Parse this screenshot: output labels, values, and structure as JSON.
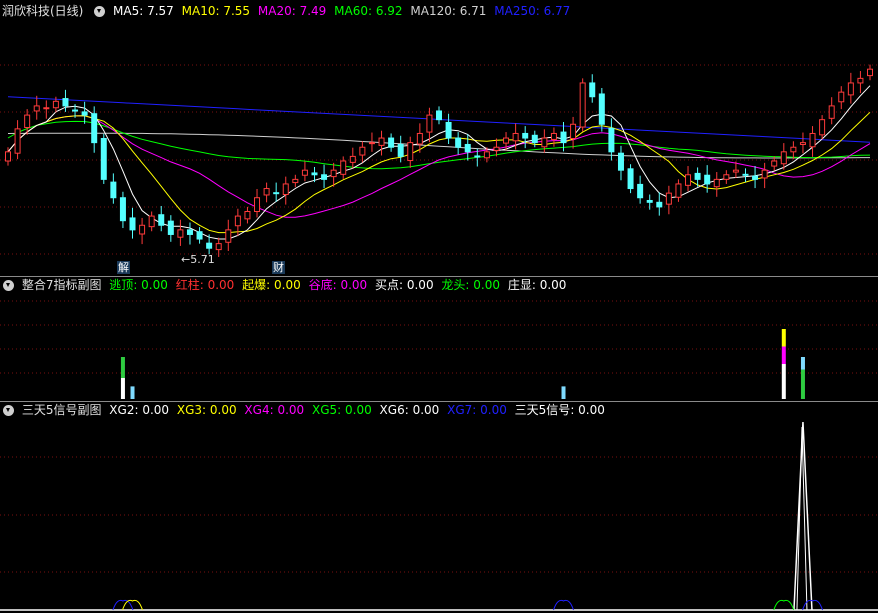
{
  "main": {
    "title": "润欣科技(日线)",
    "ma": [
      {
        "label": "MA5: 7.57",
        "color": "#ffffff"
      },
      {
        "label": "MA10: 7.55",
        "color": "#ffff00"
      },
      {
        "label": "MA20: 7.49",
        "color": "#ff00ff"
      },
      {
        "label": "MA60: 6.92",
        "color": "#00ff00"
      },
      {
        "label": "MA120: 6.71",
        "color": "#d0d0d0"
      },
      {
        "label": "MA250: 6.77",
        "color": "#2020ff"
      }
    ],
    "low_label": "←5.71",
    "event_labels": [
      "解",
      "财"
    ]
  },
  "sub1": {
    "title": "整合7指标副图",
    "items": [
      {
        "name": "逃顶",
        "value": "0.00",
        "color": "#00ff00"
      },
      {
        "name": "红柱",
        "value": "0.00",
        "color": "#ff3030"
      },
      {
        "name": "起爆",
        "value": "0.00",
        "color": "#ffff00"
      },
      {
        "name": "谷底",
        "value": "0.00",
        "color": "#ff00ff"
      },
      {
        "name": "买点",
        "value": "0.00",
        "color": "#ffffff"
      },
      {
        "name": "龙头",
        "value": "0.00",
        "color": "#00ff00"
      },
      {
        "name": "庄显",
        "value": "0.00",
        "color": "#ffffff"
      }
    ]
  },
  "sub2": {
    "title": "三天5信号副图",
    "items": [
      {
        "name": "XG2",
        "value": "0.00",
        "color": "#ffffff"
      },
      {
        "name": "XG3",
        "value": "0.00",
        "color": "#ffff00"
      },
      {
        "name": "XG4",
        "value": "0.00",
        "color": "#ff00ff"
      },
      {
        "name": "XG5",
        "value": "0.00",
        "color": "#00ff00"
      },
      {
        "name": "XG6",
        "value": "0.00",
        "color": "#ffffff"
      },
      {
        "name": "XG7",
        "value": "0.00",
        "color": "#2020ff"
      },
      {
        "name": "三天5信号",
        "value": "0.00",
        "color": "#ffffff"
      }
    ]
  },
  "chart_data": {
    "type": "candlestick",
    "closes": [
      6.8,
      7.05,
      7.2,
      7.3,
      7.28,
      7.35,
      7.3,
      7.25,
      7.2,
      6.9,
      6.5,
      6.3,
      6.05,
      5.95,
      6.0,
      6.1,
      6.0,
      5.9,
      5.95,
      5.9,
      5.85,
      5.75,
      5.8,
      5.95,
      6.1,
      6.15,
      6.3,
      6.4,
      6.35,
      6.45,
      6.5,
      6.6,
      6.55,
      6.5,
      6.6,
      6.7,
      6.75,
      6.85,
      6.9,
      6.95,
      6.85,
      6.75,
      6.9,
      7.0,
      7.2,
      7.15,
      6.95,
      6.85,
      6.8,
      6.75,
      6.8,
      6.85,
      6.95,
      7.0,
      6.95,
      6.9,
      6.95,
      7.0,
      6.9,
      7.1,
      7.55,
      7.4,
      7.1,
      6.8,
      6.6,
      6.4,
      6.3,
      6.25,
      6.2,
      6.35,
      6.45,
      6.55,
      6.5,
      6.45,
      6.5,
      6.55,
      6.6,
      6.55,
      6.5,
      6.6,
      6.7,
      6.8,
      6.85,
      6.9,
      7.0,
      7.15,
      7.3,
      7.45,
      7.55,
      7.6,
      7.7
    ],
    "low_marker": 5.71,
    "sub1_bars": [
      {
        "index": 12,
        "values": [
          {
            "color": "#ffffff",
            "h": 0.5
          },
          {
            "color": "#2ecc40",
            "h": 0.5
          }
        ]
      },
      {
        "index": 13,
        "values": [
          {
            "color": "#7fdbff",
            "h": 0.3
          }
        ]
      },
      {
        "index": 58,
        "values": [
          {
            "color": "#7fdbff",
            "h": 0.3
          }
        ]
      },
      {
        "index": 81,
        "values": [
          {
            "color": "#ffffff",
            "h": 1.0
          },
          {
            "color": "#ff00ff",
            "h": 0.5
          },
          {
            "color": "#ffff00",
            "h": 0.5
          }
        ]
      },
      {
        "index": 83,
        "values": [
          {
            "color": "#2ecc40",
            "h": 0.7
          },
          {
            "color": "#7fdbff",
            "h": 0.3
          }
        ]
      }
    ],
    "sub2_spike_index": 83
  }
}
